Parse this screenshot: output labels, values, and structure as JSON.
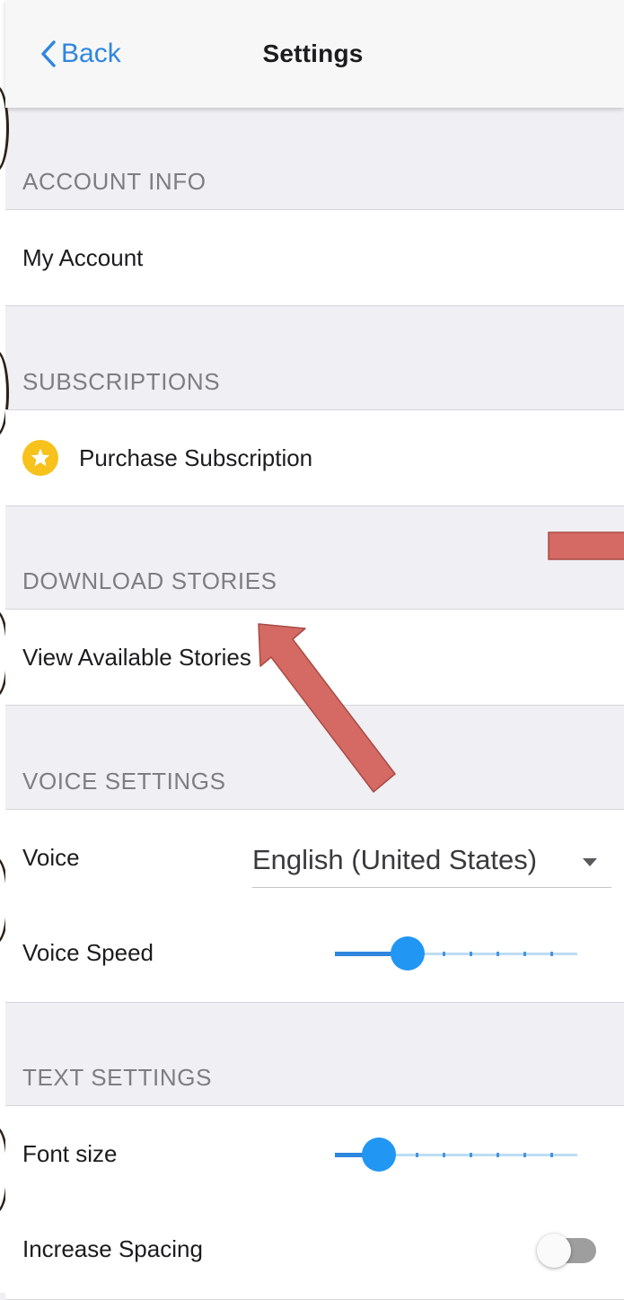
{
  "nav": {
    "back_label": "Back",
    "title": "Settings"
  },
  "sections": {
    "account": {
      "header": "ACCOUNT INFO",
      "my_account": "My Account"
    },
    "subscriptions": {
      "header": "SUBSCRIPTIONS",
      "purchase": "Purchase Subscription"
    },
    "download": {
      "header": "DOWNLOAD STORIES",
      "view_available": "View Available Stories"
    },
    "voice": {
      "header": "VOICE SETTINGS",
      "voice_label": "Voice",
      "voice_value": "English (United States)",
      "speed_label": "Voice Speed",
      "speed_value_fraction": 0.3
    },
    "text": {
      "header": "TEXT SETTINGS",
      "font_label": "Font size",
      "font_value_fraction": 0.18,
      "spacing_label": "Increase Spacing",
      "spacing_on": false
    }
  },
  "colors": {
    "accent": "#2e86de",
    "slider_thumb": "#2196f3",
    "star": "#f6c21b",
    "annotation": "#d46a63"
  }
}
